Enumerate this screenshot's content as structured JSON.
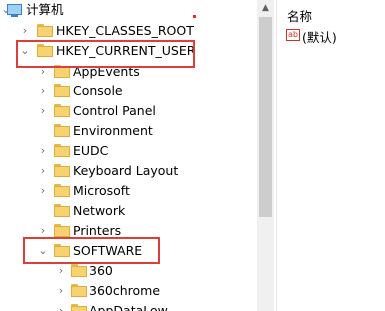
{
  "tree": {
    "root_label": "计算机",
    "items": [
      {
        "label": "HKEY_CLASSES_ROOT"
      },
      {
        "label": "HKEY_CURRENT_USER"
      },
      {
        "label": "AppEvents"
      },
      {
        "label": "Console"
      },
      {
        "label": "Control Panel"
      },
      {
        "label": "Environment"
      },
      {
        "label": "EUDC"
      },
      {
        "label": "Keyboard Layout"
      },
      {
        "label": "Microsoft"
      },
      {
        "label": "Network"
      },
      {
        "label": "Printers"
      },
      {
        "label": "SOFTWARE"
      },
      {
        "label": "360"
      },
      {
        "label": "360chrome"
      },
      {
        "label": "AppDataLow"
      }
    ]
  },
  "right_pane": {
    "column_name": "名称",
    "value_icon_text": "ab",
    "default_value": "(默认)"
  },
  "colors": {
    "highlight_box": "#d9403b",
    "folder": "#f7d271",
    "scrollbar_thumb": "#cdcdcd"
  }
}
